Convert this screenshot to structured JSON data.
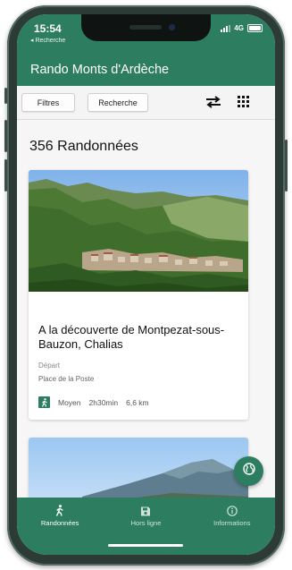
{
  "status_bar": {
    "time": "15:54",
    "back_label": "◂ Recherche",
    "network": "4G"
  },
  "app": {
    "title": "Rando Monts d'Ardèche",
    "accent": "#2d7e61"
  },
  "toolbar": {
    "filters_label": "Filtres",
    "search_label": "Recherche",
    "sort_icon": "swap-arrows-icon",
    "grid_icon": "grid-view-icon"
  },
  "list": {
    "count_label": "356 Randonnées",
    "items": [
      {
        "title": "A la découverte de Montpezat-sous-Bauzon, Chalias",
        "depart_label": "Départ",
        "depart_place": "Place de la Poste",
        "difficulty": "Moyen",
        "duration": "2h30min",
        "distance": "6,6 km"
      }
    ]
  },
  "nav": {
    "items": [
      {
        "label": "Randonnées",
        "icon": "hiker-icon"
      },
      {
        "label": "Hors ligne",
        "icon": "save-icon"
      },
      {
        "label": "Informations",
        "icon": "info-icon"
      }
    ]
  }
}
